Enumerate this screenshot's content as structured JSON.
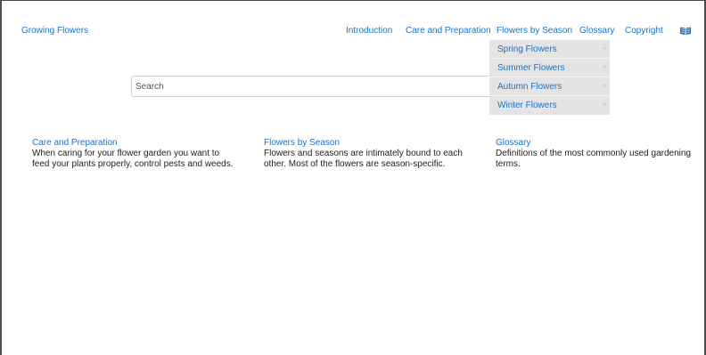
{
  "brand": "Growing Flowers",
  "nav": {
    "introduction": "Introduction",
    "care": "Care and Preparation",
    "season": "Flowers by Season",
    "glossary": "Glossary",
    "copyright": "Copyright",
    "book_icon": "book-icon"
  },
  "dropdown": {
    "items": [
      {
        "label": "Spring Flowers",
        "arrow": "»"
      },
      {
        "label": "Summer Flowers",
        "arrow": "»"
      },
      {
        "label": "Autumn Flowers",
        "arrow": "»"
      },
      {
        "label": "Winter Flowers",
        "arrow": "»"
      }
    ]
  },
  "search": {
    "placeholder": "Search"
  },
  "sections": [
    {
      "title": "Care and Preparation",
      "text": "When caring for your flower garden you want to feed your plants properly, control pests and weeds."
    },
    {
      "title": "Flowers by Season",
      "text": "Flowers and seasons are intimately bound to each other. Most of the flowers are season-specific."
    },
    {
      "title": "Glossary",
      "text": "Definitions of the most commonly used gardening terms."
    }
  ],
  "colors": {
    "link": "#1a73c8",
    "dropdown_bg": "#e4e4e4"
  }
}
